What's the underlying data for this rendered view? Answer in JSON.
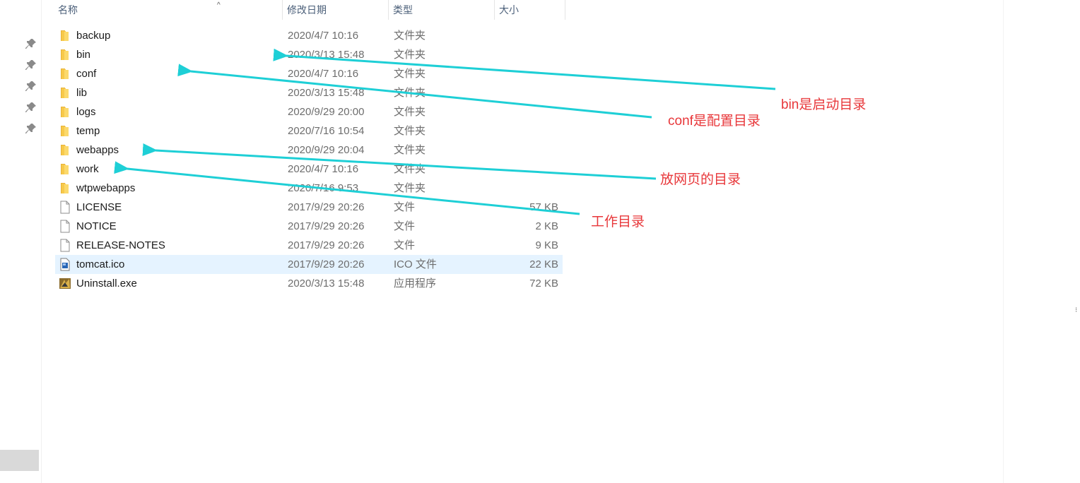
{
  "headers": {
    "name": "名称",
    "date": "修改日期",
    "type": "类型",
    "size": "大小"
  },
  "files": [
    {
      "name": "backup",
      "date": "2020/4/7 10:16",
      "type": "文件夹",
      "size": "",
      "icon": "folder-icon"
    },
    {
      "name": "bin",
      "date": "2020/3/13 15:48",
      "type": "文件夹",
      "size": "",
      "icon": "folder-icon"
    },
    {
      "name": "conf",
      "date": "2020/4/7 10:16",
      "type": "文件夹",
      "size": "",
      "icon": "folder-icon"
    },
    {
      "name": "lib",
      "date": "2020/3/13 15:48",
      "type": "文件夹",
      "size": "",
      "icon": "folder-icon"
    },
    {
      "name": "logs",
      "date": "2020/9/29 20:00",
      "type": "文件夹",
      "size": "",
      "icon": "folder-icon"
    },
    {
      "name": "temp",
      "date": "2020/7/16 10:54",
      "type": "文件夹",
      "size": "",
      "icon": "folder-icon"
    },
    {
      "name": "webapps",
      "date": "2020/9/29 20:04",
      "type": "文件夹",
      "size": "",
      "icon": "folder-icon"
    },
    {
      "name": "work",
      "date": "2020/4/7 10:16",
      "type": "文件夹",
      "size": "",
      "icon": "folder-icon"
    },
    {
      "name": "wtpwebapps",
      "date": "2020/7/16 9:53",
      "type": "文件夹",
      "size": "",
      "icon": "folder-icon"
    },
    {
      "name": "LICENSE",
      "date": "2017/9/29 20:26",
      "type": "文件",
      "size": "57 KB",
      "icon": "file-icon"
    },
    {
      "name": "NOTICE",
      "date": "2017/9/29 20:26",
      "type": "文件",
      "size": "2 KB",
      "icon": "file-icon"
    },
    {
      "name": "RELEASE-NOTES",
      "date": "2017/9/29 20:26",
      "type": "文件",
      "size": "9 KB",
      "icon": "file-icon"
    },
    {
      "name": "tomcat.ico",
      "date": "2017/9/29 20:26",
      "type": "ICO 文件",
      "size": "22 KB",
      "icon": "ico-file-icon"
    },
    {
      "name": "Uninstall.exe",
      "date": "2020/3/13 15:48",
      "type": "应用程序",
      "size": "72 KB",
      "icon": "exe-icon"
    }
  ],
  "selected_file": "tomcat.ico",
  "annotations": {
    "bin": "bin是启动目录",
    "conf": "conf是配置目录",
    "webapps": "放网页的目录",
    "work": "工作目录"
  },
  "colors": {
    "arrow": "#1ecfd6",
    "annotation_text": "#e8373a",
    "folder": "#f7c94a",
    "selection": "#e5f3ff"
  }
}
